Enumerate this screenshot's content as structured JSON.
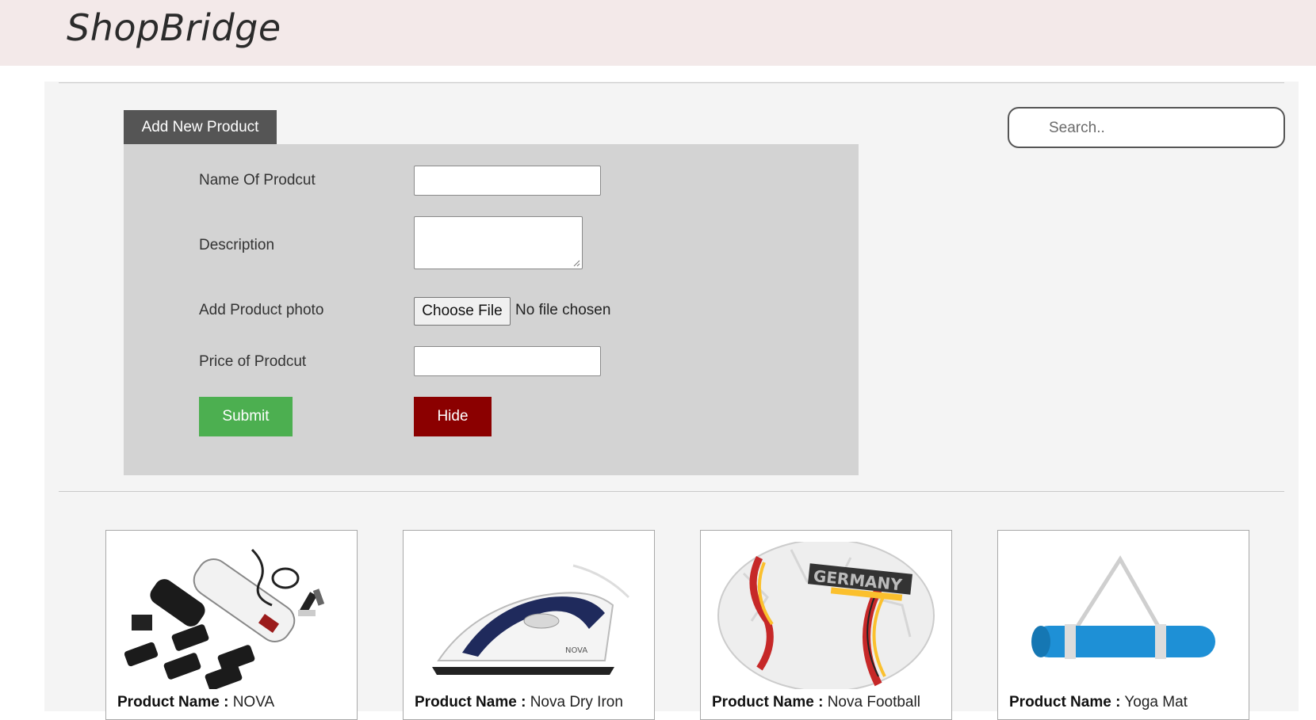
{
  "header": {
    "brand": "ShopBridge"
  },
  "form": {
    "tab_label": "Add New Product",
    "name_label": "Name Of Prodcut",
    "description_label": "Description",
    "photo_label": "Add Product photo",
    "file_button": "Choose File",
    "file_status": "No file chosen",
    "price_label": "Price of Prodcut",
    "submit_label": "Submit",
    "hide_label": "Hide"
  },
  "search": {
    "placeholder": "Search.."
  },
  "products": [
    {
      "name_label": "Product Name :",
      "name": "NOVA"
    },
    {
      "name_label": "Product Name :",
      "name": "Nova Dry Iron"
    },
    {
      "name_label": "Product Name :",
      "name": "Nova Football"
    },
    {
      "name_label": "Product Name :",
      "name": "Yoga Mat"
    }
  ],
  "icons": {
    "search": "search-icon",
    "trimmer": "trimmer-image",
    "iron": "iron-image",
    "football": "football-image",
    "yoga_mat": "yoga-mat-image"
  },
  "colors": {
    "header_bg": "#f3e9e9",
    "tab_bg": "#555555",
    "form_bg": "#d3d3d3",
    "submit": "#4caf50",
    "hide": "#8b0000"
  }
}
